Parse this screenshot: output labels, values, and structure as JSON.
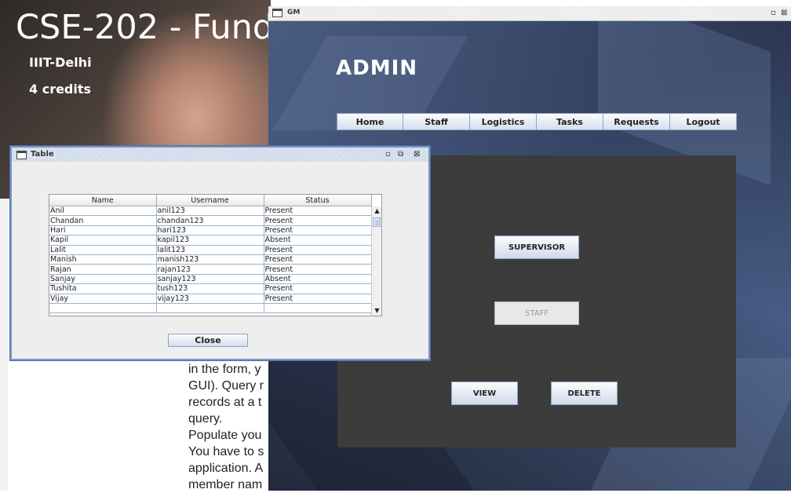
{
  "background_page": {
    "course_title": "CSE-202 - Fund",
    "institute": "IIIT-Delhi",
    "credits": "4 credits",
    "text_lines": [
      "in the form, y",
      "GUI). Query r",
      "records at a t",
      "query.",
      "Populate you",
      "You have to s",
      "application. A",
      "member nam"
    ]
  },
  "gm_window": {
    "title": "GM",
    "controls": {
      "restore": "▫",
      "close": "⊠"
    },
    "heading": "ADMIN",
    "menu": [
      {
        "label": "Home"
      },
      {
        "label": "Staff"
      },
      {
        "label": "Logistics"
      },
      {
        "label": "Tasks"
      },
      {
        "label": "Requests"
      },
      {
        "label": "Logout"
      }
    ],
    "buttons": {
      "supervisor": "SUPERVISOR",
      "staff": "STAFF",
      "view": "VIEW",
      "delete": "DELETE"
    }
  },
  "table_window": {
    "title": "Table",
    "controls": {
      "minimize": "▫",
      "maximize": "⧉",
      "close": "⊠"
    },
    "columns": [
      "Name",
      "Username",
      "Status"
    ],
    "rows": [
      [
        "Anil",
        "anil123",
        "Present"
      ],
      [
        "Chandan",
        "chandan123",
        "Present"
      ],
      [
        "Hari",
        "hari123",
        "Present"
      ],
      [
        "Kapil",
        "kapil123",
        "Absent"
      ],
      [
        "Lalit",
        "lalit123",
        "Present"
      ],
      [
        "Manish",
        "manish123",
        "Present"
      ],
      [
        "Rajan",
        "rajan123",
        "Present"
      ],
      [
        "Sanjay",
        "sanjay123",
        "Absent"
      ],
      [
        "Tushita",
        "tush123",
        "Present"
      ],
      [
        "Vijay",
        "vijay123",
        "Present"
      ],
      [
        "",
        "",
        ""
      ]
    ],
    "close_label": "Close"
  },
  "icons": {
    "scroll_up": "▲",
    "scroll_down": "▼",
    "window_icon": "window-icon"
  }
}
